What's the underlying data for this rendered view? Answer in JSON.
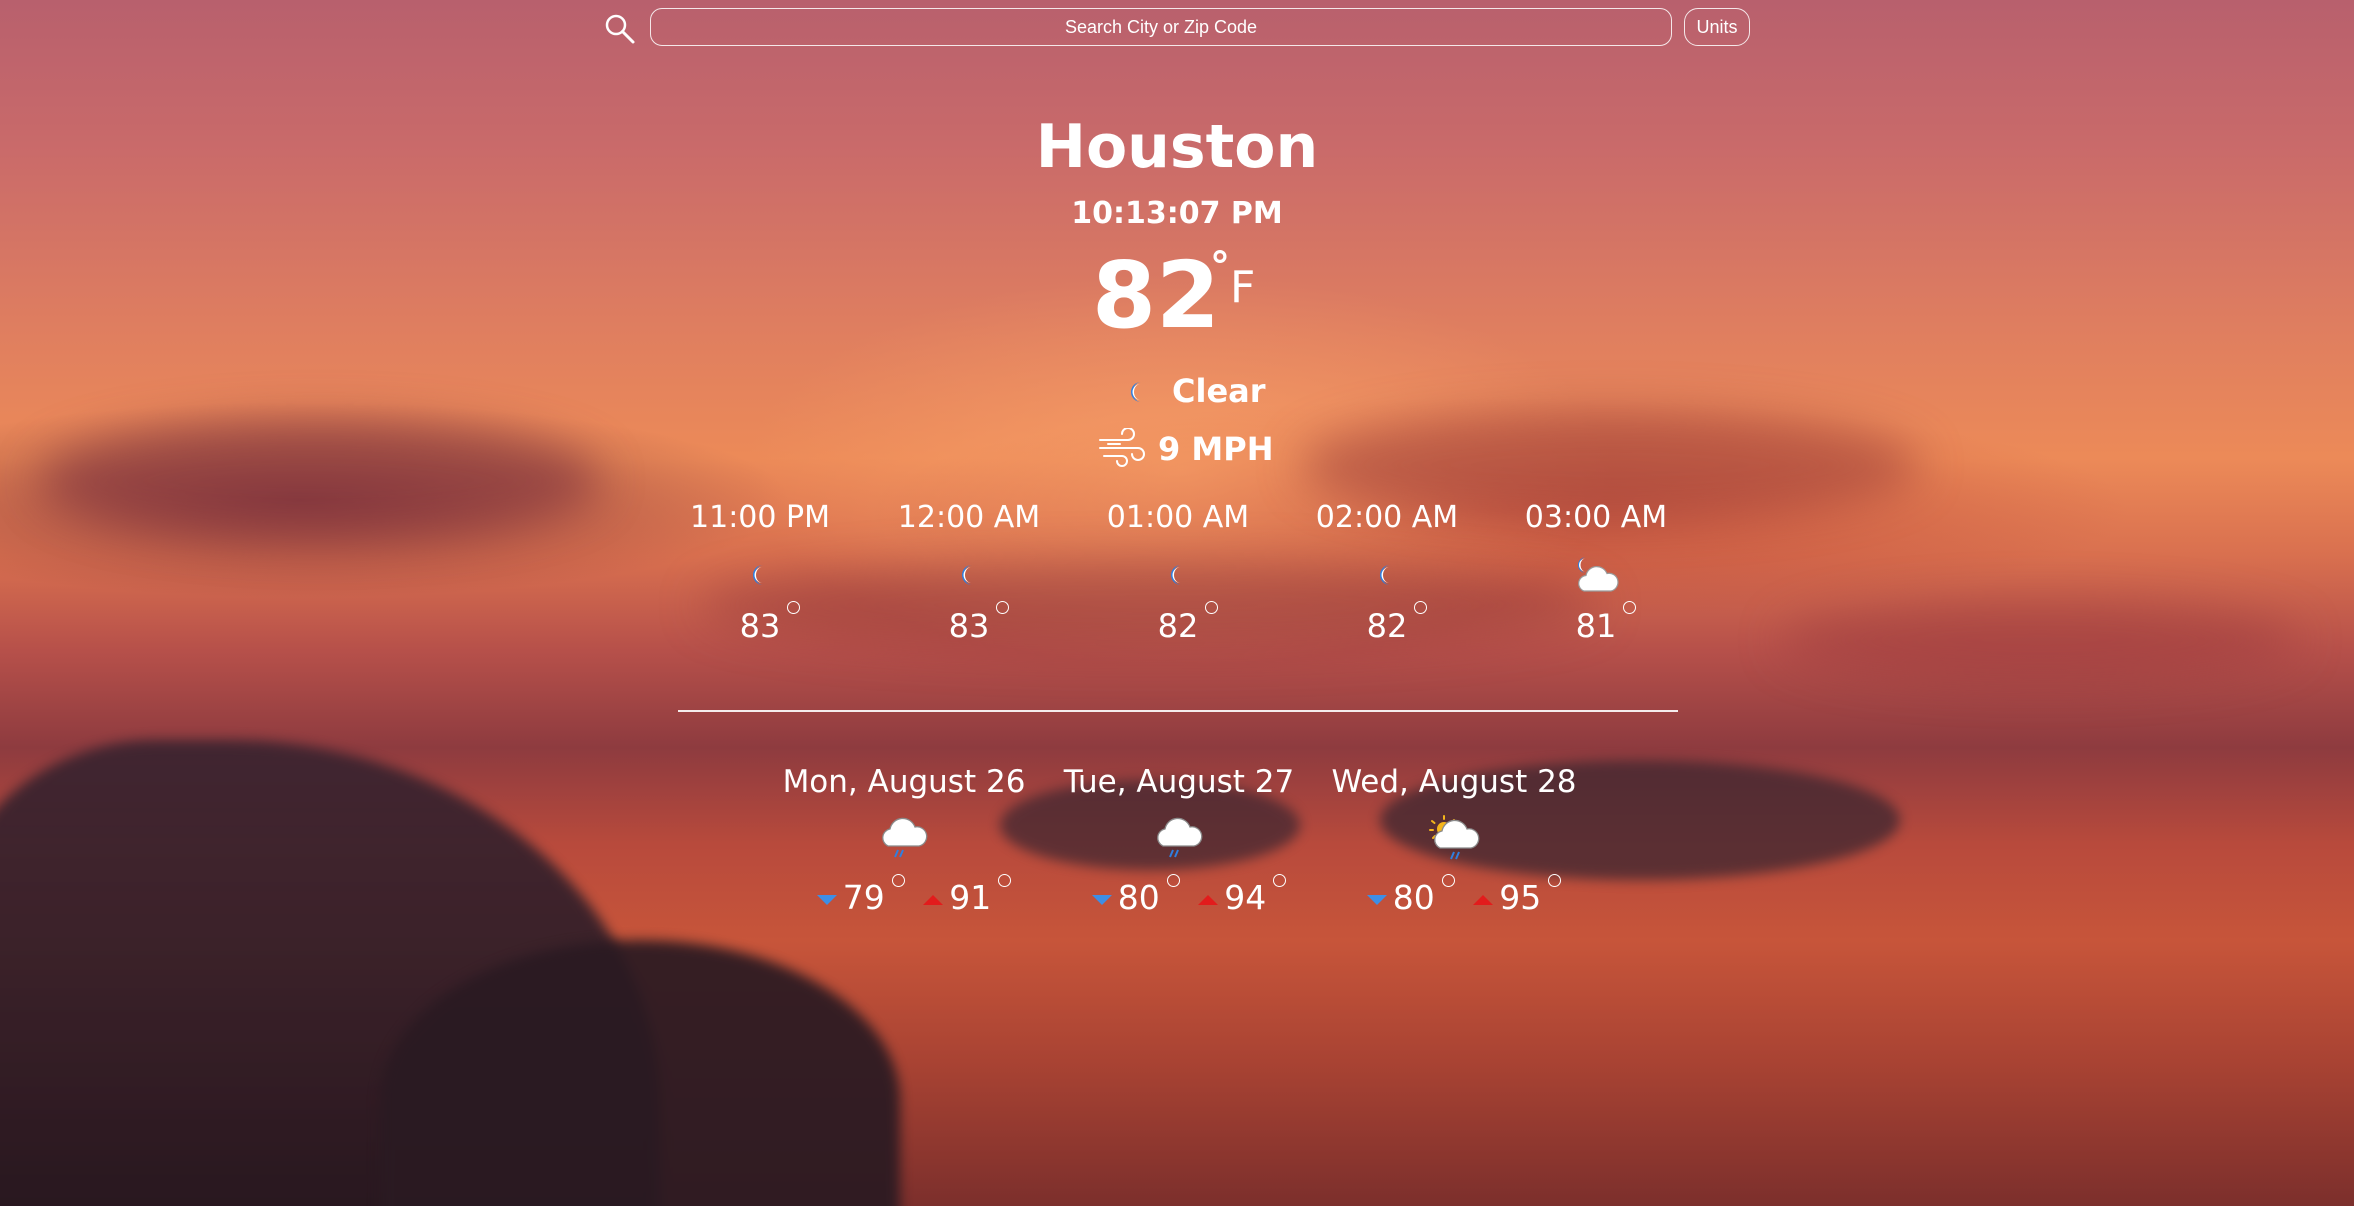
{
  "search": {
    "placeholder": "Search City or Zip Code",
    "icon": "search-icon"
  },
  "units_button": {
    "label": "Units"
  },
  "current": {
    "city": "Houston",
    "time": "10:13:07 PM",
    "temperature": "82",
    "degree_symbol": "°",
    "unit": "F",
    "condition": "Clear",
    "condition_icon": "moon-icon",
    "wind": "9 MPH",
    "wind_icon": "wind-icon"
  },
  "hourly": [
    {
      "time": "11:00 PM",
      "temp": "83",
      "icon": "moon-icon"
    },
    {
      "time": "12:00 AM",
      "temp": "83",
      "icon": "moon-icon"
    },
    {
      "time": "01:00 AM",
      "temp": "82",
      "icon": "moon-icon"
    },
    {
      "time": "02:00 AM",
      "temp": "82",
      "icon": "moon-icon"
    },
    {
      "time": "03:00 AM",
      "temp": "81",
      "icon": "moon-cloud-icon"
    }
  ],
  "daily": [
    {
      "day": "Mon, August 26",
      "low": "79",
      "high": "91",
      "icon": "rain-cloud-icon"
    },
    {
      "day": "Tue, August 27",
      "low": "80",
      "high": "94",
      "icon": "rain-cloud-icon"
    },
    {
      "day": "Wed, August 28",
      "low": "80",
      "high": "95",
      "icon": "sun-rain-cloud-icon"
    }
  ],
  "colors": {
    "low_arrow": "#3d8ee6",
    "high_arrow": "#e21c1c",
    "text": "#ffffff"
  }
}
